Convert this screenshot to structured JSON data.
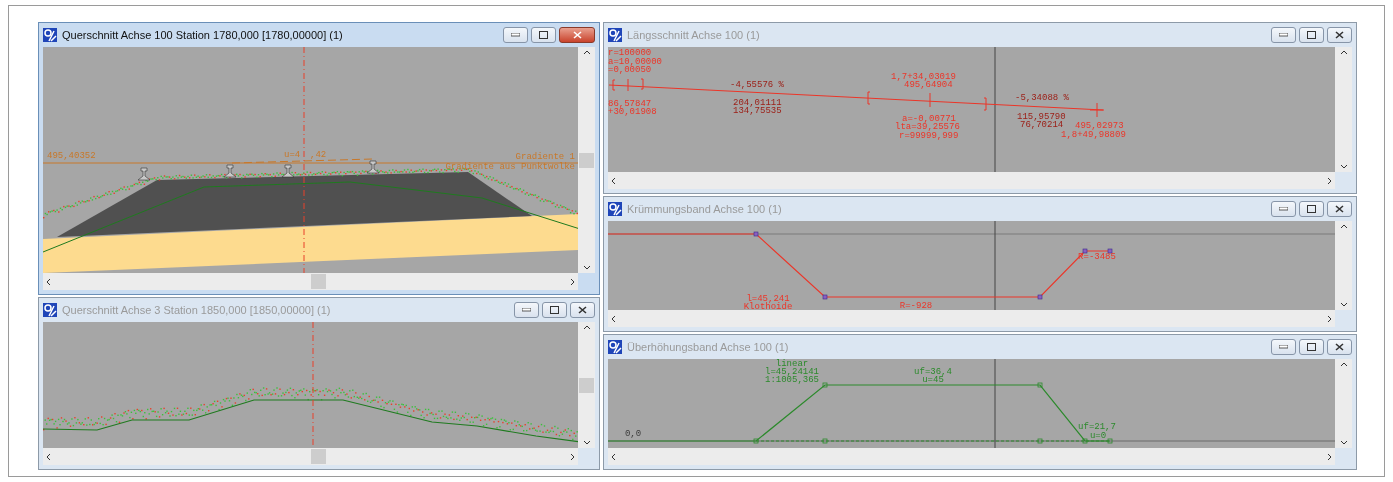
{
  "windows": [
    {
      "title": "Querschnitt Achse 100 Station 1780,000 [1780,00000] (1)",
      "active": true,
      "kind": "track_section",
      "labels": [
        {
          "text": "495,40352",
          "faint": false
        },
        {
          "text": "u=4",
          "faint": false
        },
        {
          "text": ",42",
          "faint": false
        },
        {
          "text": "Gradiente 1",
          "faint": false
        },
        {
          "text": "Gradiente aus Punktwolke",
          "faint": false
        }
      ]
    },
    {
      "title": "Querschnitt Achse 3 Station 1850,000 [1850,00000] (1)",
      "active": false,
      "kind": "terrain_section"
    },
    {
      "title": "Längsschnitt Achse 100 (1)",
      "active": false,
      "kind": "profile",
      "labels": [
        {
          "text": "r=100000",
          "faint": false
        },
        {
          "text": "a=10,00000",
          "faint": false
        },
        {
          "text": "=0,00050",
          "faint": false
        },
        {
          "text": "86,57847",
          "faint": false
        },
        {
          "text": "+30,01908",
          "faint": false
        },
        {
          "text": "-4,55576 %",
          "faint": true
        },
        {
          "text": "204,01111",
          "faint": true
        },
        {
          "text": "134,75535",
          "faint": true
        },
        {
          "text": "1,7+34,03019",
          "faint": false
        },
        {
          "text": "495,64904",
          "faint": false
        },
        {
          "text": "a=-0,00771",
          "faint": false
        },
        {
          "text": "lta=39,25576",
          "faint": false
        },
        {
          "text": "r=99999,999",
          "faint": false
        },
        {
          "text": "-5,34088 %",
          "faint": true
        },
        {
          "text": "115,95790",
          "faint": true
        },
        {
          "text": "76,70214",
          "faint": true
        },
        {
          "text": "495,02973",
          "faint": false
        },
        {
          "text": "1,8+49,98809",
          "faint": false
        }
      ]
    },
    {
      "title": "Krümmungsband Achse 100 (1)",
      "active": false,
      "kind": "curvature",
      "labels": [
        {
          "text": "R=-3485",
          "faint": false
        },
        {
          "text": "l=45,241",
          "faint": false
        },
        {
          "text": "Klothoide",
          "faint": false
        },
        {
          "text": "R=-928",
          "faint": false
        }
      ]
    },
    {
      "title": "Überhöhungsband Achse 100 (1)",
      "active": false,
      "kind": "superelevation",
      "labels": [
        {
          "text": "linear",
          "faint": false
        },
        {
          "text": "l=45,24141",
          "faint": false
        },
        {
          "text": "1:1005,365",
          "faint": false
        },
        {
          "text": "uf=36,4",
          "faint": false
        },
        {
          "text": "u=45",
          "faint": false
        },
        {
          "text": "0,0",
          "faint": true
        },
        {
          "text": "uf=21,7",
          "faint": false
        },
        {
          "text": "u=0",
          "faint": false
        }
      ]
    }
  ]
}
